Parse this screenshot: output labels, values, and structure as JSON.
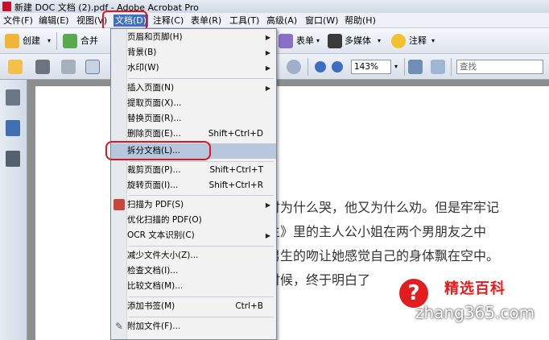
{
  "window": {
    "title": "新建 DOC 文档 (2).pdf - Adobe Acrobat Pro"
  },
  "menubar": {
    "items": [
      "文件(F)",
      "编辑(E)",
      "视图(V)",
      "文档(D)",
      "注释(C)",
      "表单(R)",
      "工具(T)",
      "高级(A)",
      "窗口(W)",
      "帮助(H)"
    ]
  },
  "toolbar1": {
    "create": "创建",
    "combine": "合并",
    "forms": "表单",
    "multimedia": "多媒体",
    "comment": "注释"
  },
  "toolbar2": {
    "zoom": "143%",
    "search_placeholder": "查找"
  },
  "doc_menu": {
    "items": [
      {
        "label": "页眉和页脚(H)",
        "shortcut": "",
        "submenu": true
      },
      {
        "label": "背景(B)",
        "shortcut": "",
        "submenu": true
      },
      {
        "label": "水印(W)",
        "shortcut": "",
        "submenu": true
      },
      {
        "label": "插入页面(N)",
        "shortcut": "",
        "submenu": true
      },
      {
        "label": "提取页面(X)...",
        "shortcut": "",
        "submenu": false
      },
      {
        "label": "替换页面(R)...",
        "shortcut": "",
        "submenu": false
      },
      {
        "label": "删除页面(E)...",
        "shortcut": "Shift+Ctrl+D",
        "submenu": false
      },
      {
        "label": "拆分文档(L)...",
        "shortcut": "",
        "submenu": false
      },
      {
        "label": "裁剪页面(P)...",
        "shortcut": "Shift+Ctrl+T",
        "submenu": false
      },
      {
        "label": "旋转页面(I)...",
        "shortcut": "Shift+Ctrl+R",
        "submenu": false
      },
      {
        "label": "扫描为 PDF(S)",
        "shortcut": "",
        "submenu": true
      },
      {
        "label": "优化扫描的 PDF(O)",
        "shortcut": "",
        "submenu": false
      },
      {
        "label": "OCR 文本识别(C)",
        "shortcut": "",
        "submenu": true
      },
      {
        "label": "减少文件大小(Z)...",
        "shortcut": "",
        "submenu": false
      },
      {
        "label": "检查文档(I)...",
        "shortcut": "",
        "submenu": false
      },
      {
        "label": "比较文档(M)...",
        "shortcut": "",
        "submenu": false
      },
      {
        "label": "添加书签(M)",
        "shortcut": "Ctrl+B",
        "submenu": false
      },
      {
        "label": "附加文件(F)...",
        "shortcut": "",
        "submenu": false
      }
    ]
  },
  "document": {
    "lines": [
      "时为什么哭，他又为什么劝。但是牢牢记",
      "主》里的主人公小姐在两个男朋友之中",
      "男生的吻让她感觉自己的身体飘在空中。",
      "时候，终于明白了"
    ]
  },
  "watermark": {
    "brand": "精选百科",
    "url": "zhang365.com",
    "symbol": "?"
  },
  "colors": {
    "highlight": "#b7c7dd",
    "annotation_red": "#e0141e",
    "menu_active": "#3d6fc7"
  }
}
